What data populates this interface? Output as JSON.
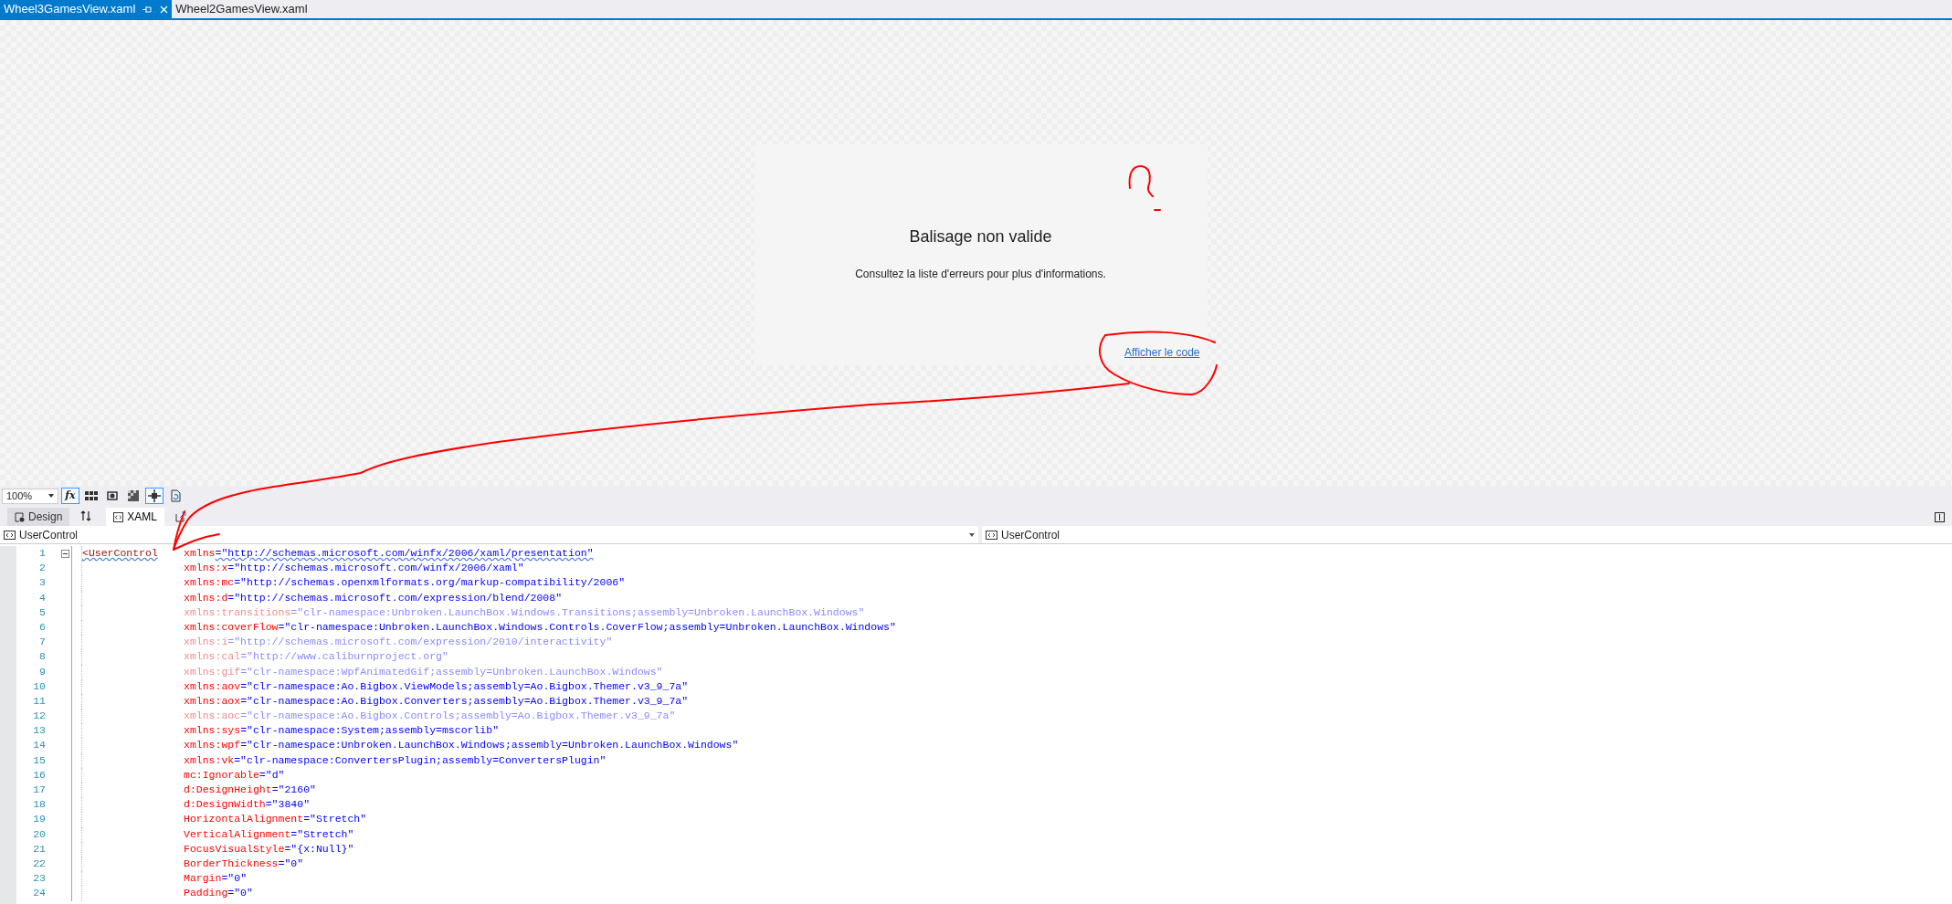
{
  "tabs": [
    {
      "label": "Wheel3GamesView.xaml",
      "selected": true
    },
    {
      "label": "Wheel2GamesView.xaml",
      "selected": false
    }
  ],
  "designer": {
    "title": "Balisage non valide",
    "message": "Consultez la liste d'erreurs pour plus d'informations.",
    "link": "Afficher le code"
  },
  "toolbar": {
    "zoom": "100%",
    "buttons": [
      {
        "kind": "fx",
        "label": "fx",
        "selected": true
      },
      {
        "kind": "grid",
        "selected": false
      },
      {
        "kind": "effects",
        "selected": false
      },
      {
        "kind": "checker",
        "selected": false
      },
      {
        "kind": "snap",
        "selected": true
      },
      {
        "kind": "refresh",
        "selected": false
      }
    ]
  },
  "view_tabs": [
    {
      "label": "Design",
      "selected": false
    },
    {
      "label": "XAML",
      "selected": true
    }
  ],
  "selectors": [
    "UserControl",
    "UserControl"
  ],
  "code": [
    {
      "n": "1",
      "tag": "<UserControl",
      "attr": "xmlns",
      "value": "=\"http://schemas.microsoft.com/winfx/2006/xaml/presentation\"",
      "faded": false,
      "error": true
    },
    {
      "n": "2",
      "attr": "xmlns:x",
      "value": "=\"http://schemas.microsoft.com/winfx/2006/xaml\"",
      "faded": false,
      "error": false
    },
    {
      "n": "3",
      "attr": "xmlns:mc",
      "value": "=\"http://schemas.openxmlformats.org/markup-compatibility/2006\"",
      "faded": false,
      "error": false
    },
    {
      "n": "4",
      "attr": "xmlns:d",
      "value": "=\"http://schemas.microsoft.com/expression/blend/2008\"",
      "faded": false,
      "error": false
    },
    {
      "n": "5",
      "attr": "xmlns:transitions",
      "value": "=\"clr-namespace:Unbroken.LaunchBox.Windows.Transitions;assembly=Unbroken.LaunchBox.Windows\"",
      "faded": true,
      "error": false
    },
    {
      "n": "6",
      "attr": "xmlns:coverFlow",
      "value": "=\"clr-namespace:Unbroken.LaunchBox.Windows.Controls.CoverFlow;assembly=Unbroken.LaunchBox.Windows\"",
      "faded": false,
      "error": false
    },
    {
      "n": "7",
      "attr": "xmlns:i",
      "value": "=\"http://schemas.microsoft.com/expression/2010/interactivity\"",
      "faded": true,
      "error": false
    },
    {
      "n": "8",
      "attr": "xmlns:cal",
      "value": "=\"http://www.caliburnproject.org\"",
      "faded": true,
      "error": false
    },
    {
      "n": "9",
      "attr": "xmlns:gif",
      "value": "=\"clr-namespace:WpfAnimatedGif;assembly=Unbroken.LaunchBox.Windows\"",
      "faded": true,
      "error": false
    },
    {
      "n": "10",
      "attr": "xmlns:aov",
      "value": "=\"clr-namespace:Ao.Bigbox.ViewModels;assembly=Ao.Bigbox.Themer.v3_9_7a\"",
      "faded": false,
      "error": false
    },
    {
      "n": "11",
      "attr": "xmlns:aox",
      "value": "=\"clr-namespace:Ao.Bigbox.Converters;assembly=Ao.Bigbox.Themer.v3_9_7a\"",
      "faded": false,
      "error": false
    },
    {
      "n": "12",
      "attr": "xmlns:aoc",
      "value": "=\"clr-namespace:Ao.Bigbox.Controls;assembly=Ao.Bigbox.Themer.v3_9_7a\"",
      "faded": true,
      "error": false
    },
    {
      "n": "13",
      "attr": "xmlns:sys",
      "value": "=\"clr-namespace:System;assembly=mscorlib\"",
      "faded": false,
      "error": false
    },
    {
      "n": "14",
      "attr": "xmlns:wpf",
      "value": "=\"clr-namespace:Unbroken.LaunchBox.Windows;assembly=Unbroken.LaunchBox.Windows\"",
      "faded": false,
      "error": false
    },
    {
      "n": "15",
      "attr": "xmlns:vk",
      "value": "=\"clr-namespace:ConvertersPlugin;assembly=ConvertersPlugin\"",
      "faded": false,
      "error": false
    },
    {
      "n": "16",
      "attr": "mc:Ignorable",
      "value": "=\"d\"",
      "faded": false,
      "error": false
    },
    {
      "n": "17",
      "attr": "d:DesignHeight",
      "value": "=\"2160\"",
      "faded": false,
      "error": false
    },
    {
      "n": "18",
      "attr": "d:DesignWidth",
      "value": "=\"3840\"",
      "faded": false,
      "error": false
    },
    {
      "n": "19",
      "attr": "HorizontalAlignment",
      "value": "=\"Stretch\"",
      "faded": false,
      "error": false
    },
    {
      "n": "20",
      "attr": "VerticalAlignment",
      "value": "=\"Stretch\"",
      "faded": false,
      "error": false
    },
    {
      "n": "21",
      "attr": "FocusVisualStyle",
      "value": "=\"{x:Null}\"",
      "faded": false,
      "error": false
    },
    {
      "n": "22",
      "attr": "BorderThickness",
      "value": "=\"0\"",
      "faded": false,
      "error": false
    },
    {
      "n": "23",
      "attr": "Margin",
      "value": "=\"0\"",
      "faded": false,
      "error": false
    },
    {
      "n": "24",
      "attr": "Padding",
      "value": "=\"0\"",
      "faded": false,
      "error": false
    }
  ]
}
